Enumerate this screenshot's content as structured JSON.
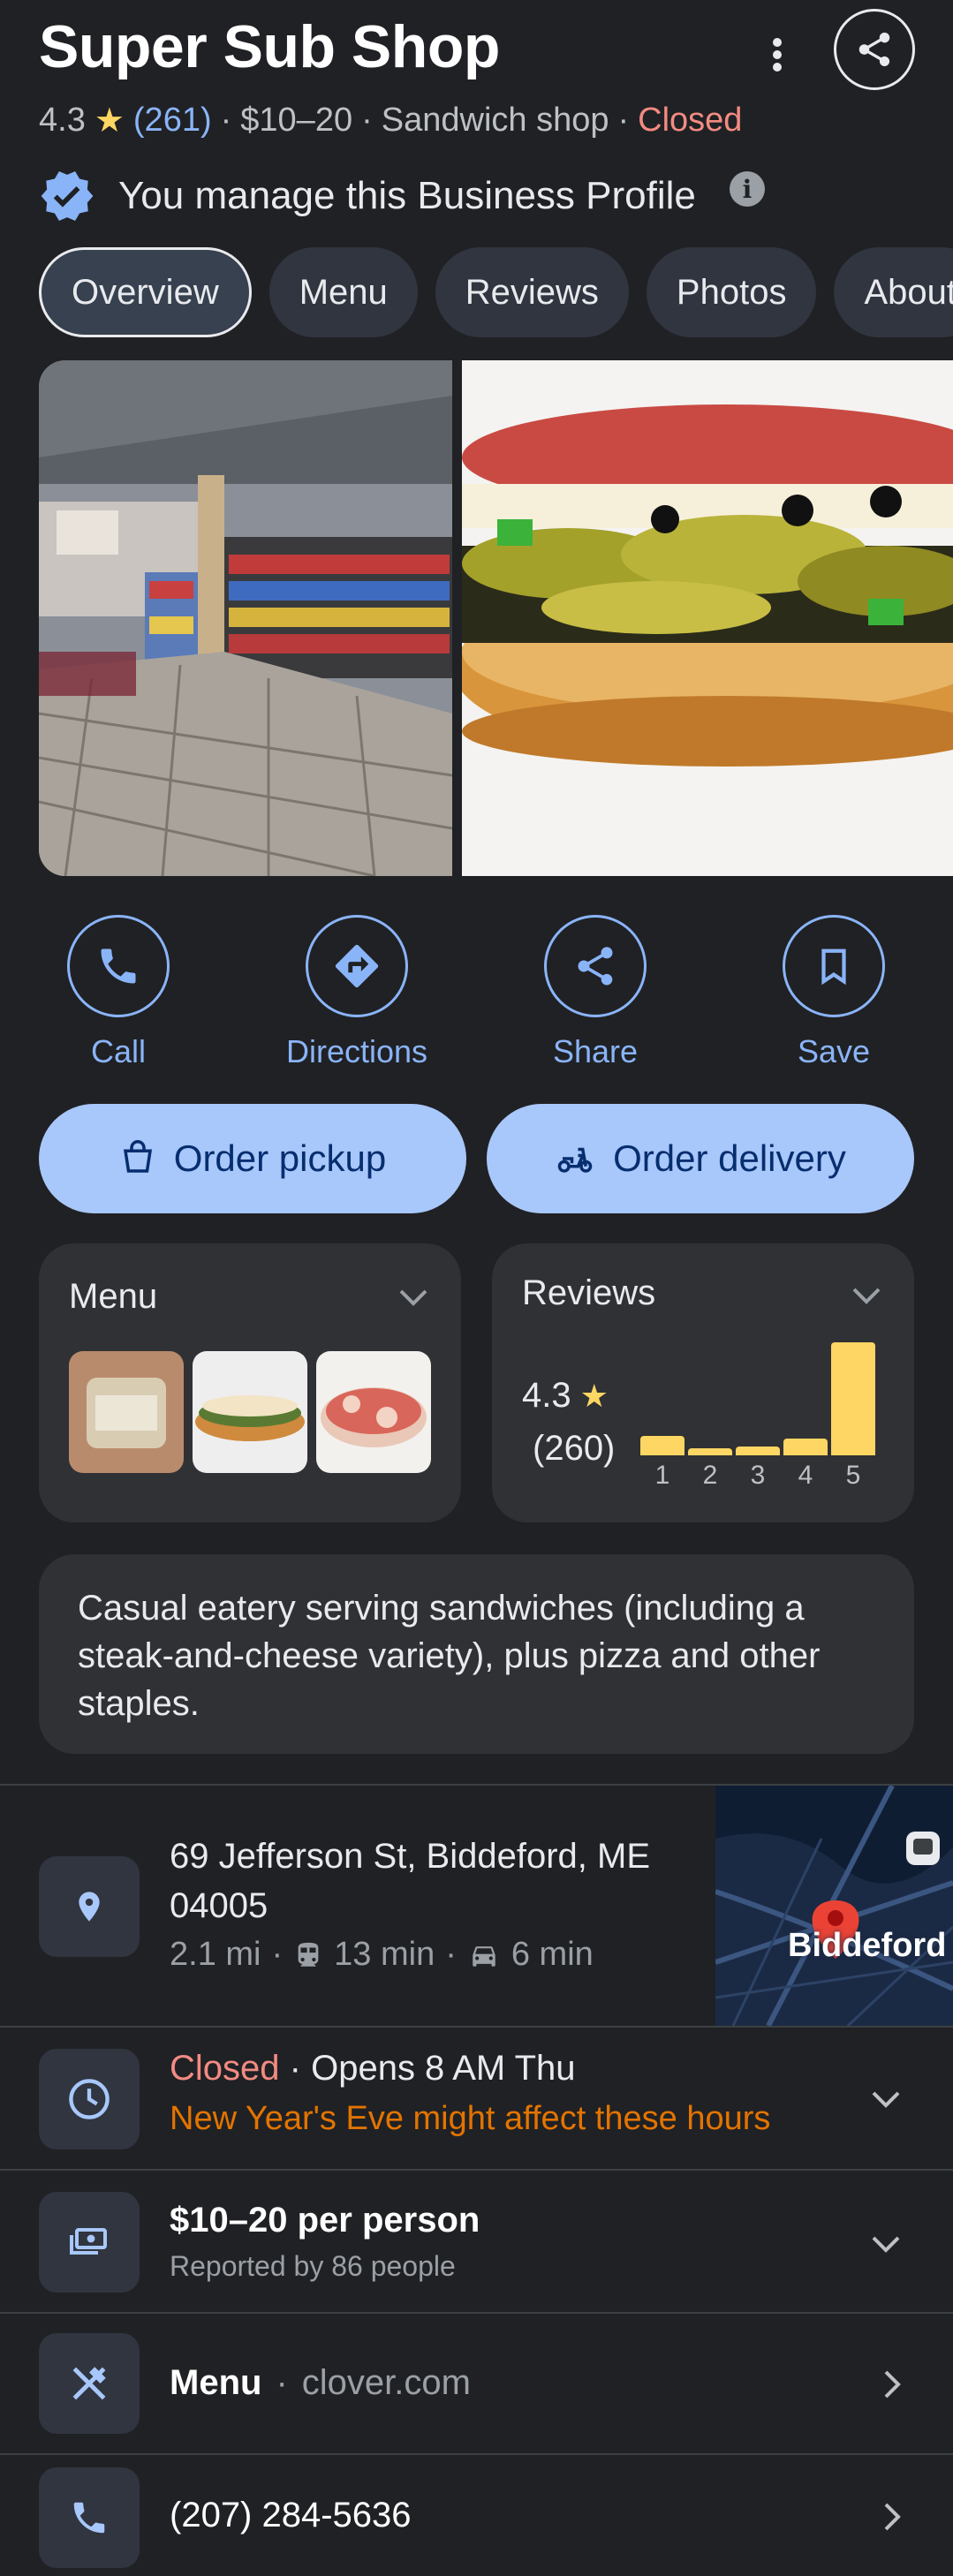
{
  "header": {
    "title": "Super Sub Shop",
    "rating": "4.3",
    "review_count": "(261)",
    "price": "$10–20",
    "category": "Sandwich shop",
    "status": "Closed",
    "sep": "·",
    "managed_text": "You manage this Business Profile",
    "info_glyph": "i"
  },
  "tabs": [
    "Overview",
    "Menu",
    "Reviews",
    "Photos",
    "About"
  ],
  "actions": {
    "call": "Call",
    "directions": "Directions",
    "share": "Share",
    "save": "Save"
  },
  "order": {
    "pickup": "Order pickup",
    "delivery": "Order delivery"
  },
  "menu_card": {
    "title": "Menu"
  },
  "reviews_card": {
    "title": "Reviews",
    "rating": "4.3",
    "count": "(260)",
    "distribution": [
      {
        "star": "1",
        "fraction": 0.17
      },
      {
        "star": "2",
        "fraction": 0.06
      },
      {
        "star": "3",
        "fraction": 0.08
      },
      {
        "star": "4",
        "fraction": 0.15
      },
      {
        "star": "5",
        "fraction": 1.0
      }
    ]
  },
  "description": "Casual eatery serving sandwiches (including a steak-and-cheese variety), plus pizza and other staples.",
  "address": {
    "line1": "69 Jefferson St, Biddeford, ME",
    "line2": "04005",
    "distance": "2.1 mi",
    "transit": "13 min",
    "drive": "6 min",
    "map_label": "Biddeford"
  },
  "hours": {
    "status": "Closed",
    "opens": "Opens 8 AM Thu",
    "note": "New Year's Eve might affect these hours"
  },
  "price_row": {
    "main": "$10–20 per person",
    "sub": "Reported by 86 people"
  },
  "menu_row": {
    "label": "Menu",
    "site": "clover.com"
  },
  "phone_row": {
    "number": "(207) 284-5636"
  },
  "colors": {
    "background": "#202124",
    "accent": "#8ab4f8",
    "closed": "#f28b82",
    "warning": "#e37400",
    "star": "#fdd663",
    "button": "#a8c7fa"
  }
}
